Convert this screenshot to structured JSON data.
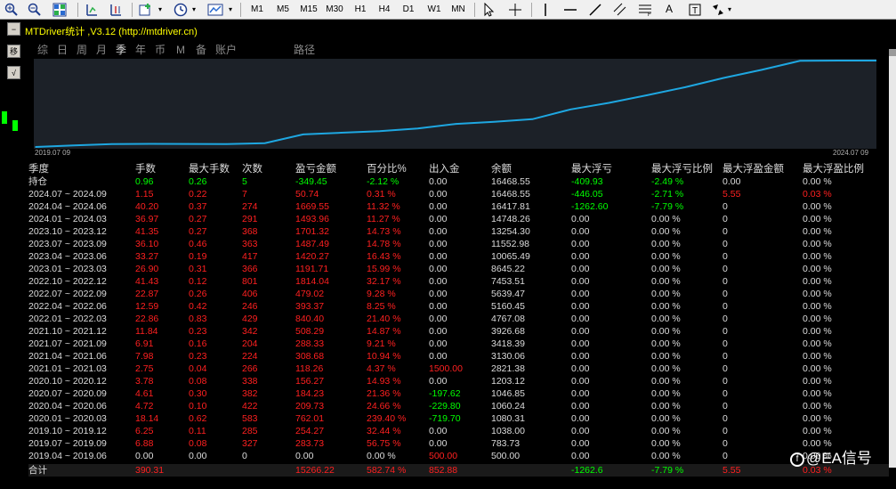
{
  "toolbar": {
    "periods": [
      "M1",
      "M5",
      "M15",
      "M30",
      "H1",
      "H4",
      "D1",
      "W1",
      "MN"
    ],
    "text_tool": "A"
  },
  "left_panel": {
    "buttons": [
      "−",
      "移",
      "√"
    ]
  },
  "window": {
    "title": "MTDriver统计 ,V3.12 (http://mtdriver.cn)",
    "period_tabs": [
      "综",
      "日",
      "周",
      "月",
      "季",
      "年",
      "币",
      "M",
      "备",
      "账户",
      "路径"
    ],
    "active_tab_index": 4
  },
  "chart_data": {
    "type": "line",
    "x_start_label": "2019.07 09",
    "x_end_label": "2024.07 09",
    "grid": false,
    "line_color": "#1ea7e1",
    "background": "#1c2128",
    "y": [
      500,
      783.73,
      1038,
      1080.31,
      1060.24,
      1046.85,
      1203.12,
      2821.38,
      3130.06,
      3418.39,
      3926.68,
      4767.08,
      5160.45,
      5639.47,
      7453.51,
      8645.22,
      10065.49,
      11552.98,
      13254.3,
      14748.26,
      16417.81,
      16468.55,
      16468.55
    ]
  },
  "table": {
    "headers": [
      "季度",
      "手数",
      "最大手数",
      "次数",
      "盈亏金额",
      "百分比%",
      "出入金",
      "余额",
      "最大浮亏",
      "最大浮亏比例",
      "最大浮盈金额",
      "最大浮盈比例"
    ],
    "position_row": {
      "cells": [
        "持仓",
        "0.96",
        "0.26",
        "5",
        "-349.45",
        "-2.12 %",
        "0.00",
        "16468.55",
        "-409.93",
        "-2.49 %",
        "0.00",
        "0.00 %"
      ],
      "colors": [
        "#dcdcdc",
        "#00ff00",
        "#00ff00",
        "#00ff00",
        "#00ff00",
        "#00ff00",
        "#dcdcdc",
        "#dcdcdc",
        "#00ff00",
        "#00ff00",
        "#dcdcdc",
        "#dcdcdc"
      ]
    },
    "rows": [
      {
        "cells": [
          "2024.07 ~ 2024.09",
          "1.15",
          "0.22",
          "7",
          "50.74",
          "0.31 %",
          "0.00",
          "16468.55",
          "-446.05",
          "-2.71 %",
          "5.55",
          "0.03 %"
        ],
        "flow": "0",
        "dd": "g",
        "fl": "r"
      },
      {
        "cells": [
          "2024.04 ~ 2024.06",
          "40.20",
          "0.37",
          "274",
          "1669.55",
          "11.32 %",
          "0.00",
          "16417.81",
          "-1262.60",
          "-7.79 %",
          "0",
          "0.00 %"
        ],
        "flow": "0",
        "dd": "g",
        "fl": "0"
      },
      {
        "cells": [
          "2024.01 ~ 2024.03",
          "36.97",
          "0.27",
          "291",
          "1493.96",
          "11.27 %",
          "0.00",
          "14748.26",
          "0.00",
          "0.00 %",
          "0",
          "0.00 %"
        ],
        "flow": "0",
        "dd": "0",
        "fl": "0"
      },
      {
        "cells": [
          "2023.10 ~ 2023.12",
          "41.35",
          "0.27",
          "368",
          "1701.32",
          "14.73 %",
          "0.00",
          "13254.30",
          "0.00",
          "0.00 %",
          "0",
          "0.00 %"
        ],
        "flow": "0",
        "dd": "0",
        "fl": "0"
      },
      {
        "cells": [
          "2023.07 ~ 2023.09",
          "36.10",
          "0.46",
          "363",
          "1487.49",
          "14.78 %",
          "0.00",
          "11552.98",
          "0.00",
          "0.00 %",
          "0",
          "0.00 %"
        ],
        "flow": "0",
        "dd": "0",
        "fl": "0"
      },
      {
        "cells": [
          "2023.04 ~ 2023.06",
          "33.27",
          "0.19",
          "417",
          "1420.27",
          "16.43 %",
          "0.00",
          "10065.49",
          "0.00",
          "0.00 %",
          "0",
          "0.00 %"
        ],
        "flow": "0",
        "dd": "0",
        "fl": "0"
      },
      {
        "cells": [
          "2023.01 ~ 2023.03",
          "26.90",
          "0.31",
          "366",
          "1191.71",
          "15.99 %",
          "0.00",
          "8645.22",
          "0.00",
          "0.00 %",
          "0",
          "0.00 %"
        ],
        "flow": "0",
        "dd": "0",
        "fl": "0"
      },
      {
        "cells": [
          "2022.10 ~ 2022.12",
          "41.43",
          "0.12",
          "801",
          "1814.04",
          "32.17 %",
          "0.00",
          "7453.51",
          "0.00",
          "0.00 %",
          "0",
          "0.00 %"
        ],
        "flow": "0",
        "dd": "0",
        "fl": "0"
      },
      {
        "cells": [
          "2022.07 ~ 2022.09",
          "22.87",
          "0.26",
          "406",
          "479.02",
          "9.28 %",
          "0.00",
          "5639.47",
          "0.00",
          "0.00 %",
          "0",
          "0.00 %"
        ],
        "flow": "0",
        "dd": "0",
        "fl": "0"
      },
      {
        "cells": [
          "2022.04 ~ 2022.06",
          "12.59",
          "0.42",
          "246",
          "393.37",
          "8.25 %",
          "0.00",
          "5160.45",
          "0.00",
          "0.00 %",
          "0",
          "0.00 %"
        ],
        "flow": "0",
        "dd": "0",
        "fl": "0"
      },
      {
        "cells": [
          "2022.01 ~ 2022.03",
          "22.86",
          "0.83",
          "429",
          "840.40",
          "21.40 %",
          "0.00",
          "4767.08",
          "0.00",
          "0.00 %",
          "0",
          "0.00 %"
        ],
        "flow": "0",
        "dd": "0",
        "fl": "0"
      },
      {
        "cells": [
          "2021.10 ~ 2021.12",
          "11.84",
          "0.23",
          "342",
          "508.29",
          "14.87 %",
          "0.00",
          "3926.68",
          "0.00",
          "0.00 %",
          "0",
          "0.00 %"
        ],
        "flow": "0",
        "dd": "0",
        "fl": "0"
      },
      {
        "cells": [
          "2021.07 ~ 2021.09",
          "6.91",
          "0.16",
          "204",
          "288.33",
          "9.21 %",
          "0.00",
          "3418.39",
          "0.00",
          "0.00 %",
          "0",
          "0.00 %"
        ],
        "flow": "0",
        "dd": "0",
        "fl": "0"
      },
      {
        "cells": [
          "2021.04 ~ 2021.06",
          "7.98",
          "0.23",
          "224",
          "308.68",
          "10.94 %",
          "0.00",
          "3130.06",
          "0.00",
          "0.00 %",
          "0",
          "0.00 %"
        ],
        "flow": "0",
        "dd": "0",
        "fl": "0"
      },
      {
        "cells": [
          "2021.01 ~ 2021.03",
          "2.75",
          "0.04",
          "266",
          "118.26",
          "4.37 %",
          "1500.00",
          "2821.38",
          "0.00",
          "0.00 %",
          "0",
          "0.00 %"
        ],
        "flow": "r",
        "dd": "0",
        "fl": "0"
      },
      {
        "cells": [
          "2020.10 ~ 2020.12",
          "3.78",
          "0.08",
          "338",
          "156.27",
          "14.93 %",
          "0.00",
          "1203.12",
          "0.00",
          "0.00 %",
          "0",
          "0.00 %"
        ],
        "flow": "0",
        "dd": "0",
        "fl": "0"
      },
      {
        "cells": [
          "2020.07 ~ 2020.09",
          "4.61",
          "0.30",
          "382",
          "184.23",
          "21.36 %",
          "-197.62",
          "1046.85",
          "0.00",
          "0.00 %",
          "0",
          "0.00 %"
        ],
        "flow": "g",
        "dd": "0",
        "fl": "0"
      },
      {
        "cells": [
          "2020.04 ~ 2020.06",
          "4.72",
          "0.10",
          "422",
          "209.73",
          "24.66 %",
          "-229.80",
          "1060.24",
          "0.00",
          "0.00 %",
          "0",
          "0.00 %"
        ],
        "flow": "g",
        "dd": "0",
        "fl": "0"
      },
      {
        "cells": [
          "2020.01 ~ 2020.03",
          "18.14",
          "0.62",
          "583",
          "762.01",
          "239.40 %",
          "-719.70",
          "1080.31",
          "0.00",
          "0.00 %",
          "0",
          "0.00 %"
        ],
        "flow": "g",
        "dd": "0",
        "fl": "0"
      },
      {
        "cells": [
          "2019.10 ~ 2019.12",
          "6.25",
          "0.11",
          "285",
          "254.27",
          "32.44 %",
          "0.00",
          "1038.00",
          "0.00",
          "0.00 %",
          "0",
          "0.00 %"
        ],
        "flow": "0",
        "dd": "0",
        "fl": "0"
      },
      {
        "cells": [
          "2019.07 ~ 2019.09",
          "6.88",
          "0.08",
          "327",
          "283.73",
          "56.75 %",
          "0.00",
          "783.73",
          "0.00",
          "0.00 %",
          "0",
          "0.00 %"
        ],
        "flow": "0",
        "dd": "0",
        "fl": "0"
      },
      {
        "cells": [
          "2019.04 ~ 2019.06",
          "0.00",
          "0.00",
          "0",
          "0.00",
          "0.00 %",
          "500.00",
          "500.00",
          "0.00",
          "0.00 %",
          "0",
          "0.00 %"
        ],
        "flow": "r",
        "dd": "0",
        "fl": "0",
        "zero": true
      }
    ],
    "total_row": {
      "cells": [
        "合计",
        "390.31",
        "",
        "",
        "15266.22",
        "582.74 %",
        "852.88",
        "",
        "-1262.6",
        "-7.79 %",
        "5.55",
        "0.03 %"
      ],
      "colors": [
        "#dcdcdc",
        "#ff2020",
        "#dcdcdc",
        "#dcdcdc",
        "#ff2020",
        "#ff2020",
        "#ff2020",
        "#dcdcdc",
        "#00ff00",
        "#00ff00",
        "#ff2020",
        "#ff2020"
      ]
    }
  },
  "watermark": {
    "text": "@EA信号",
    "icon": "facebook-icon"
  }
}
